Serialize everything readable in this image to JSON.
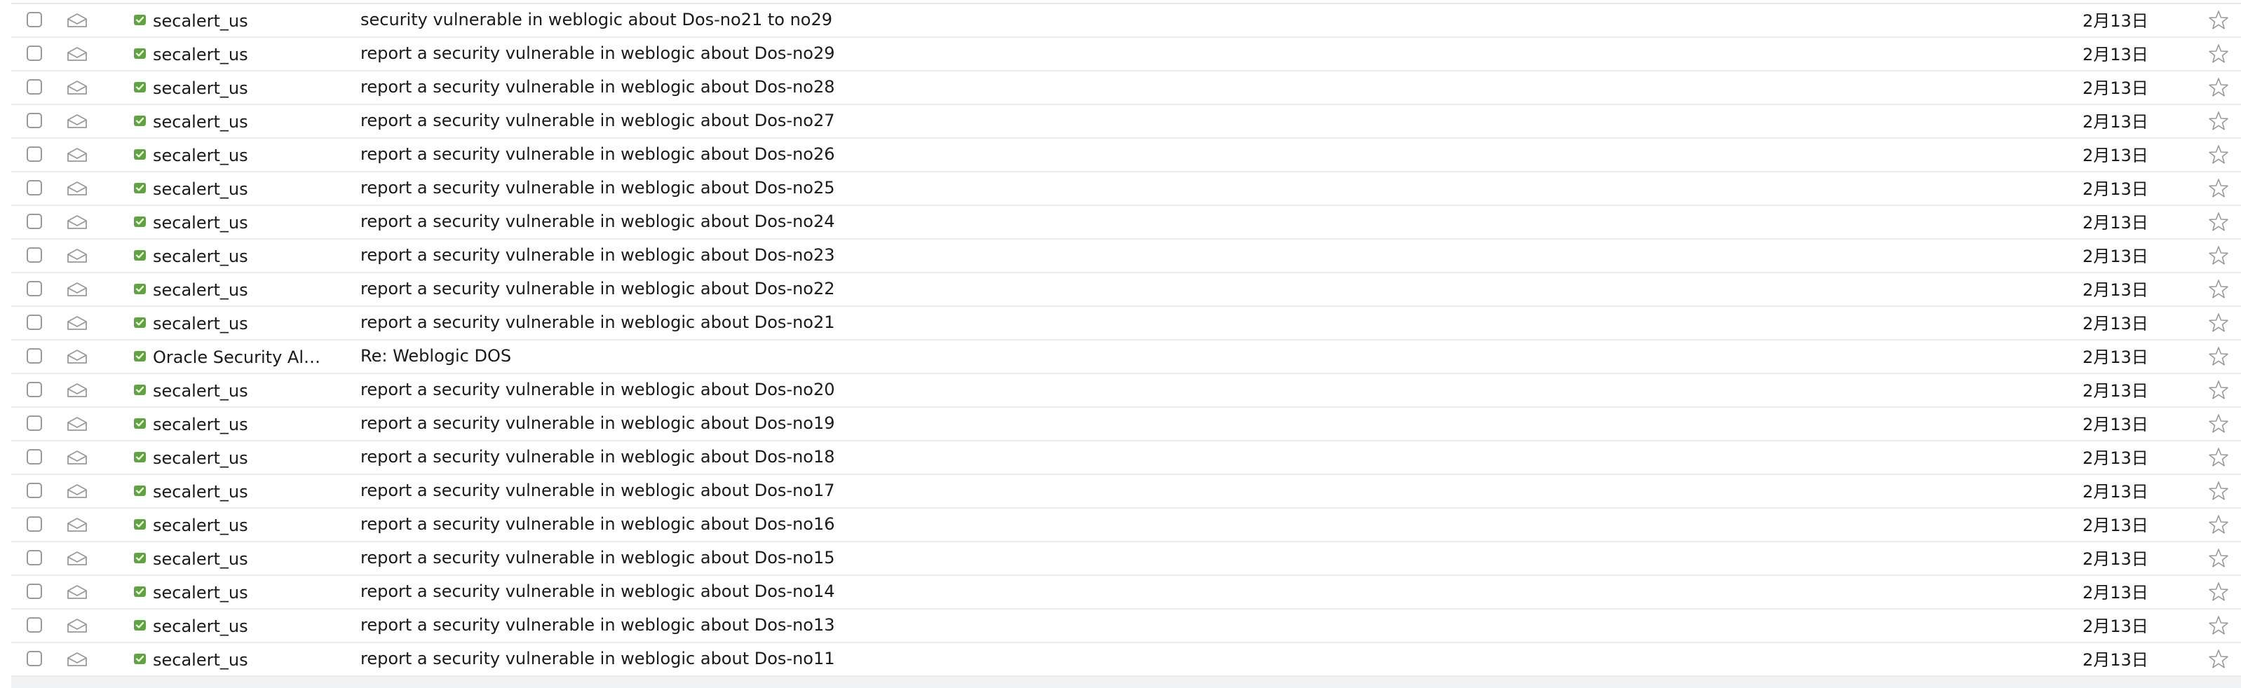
{
  "colors": {
    "verified_green": "#5aa83a",
    "icon_gray": "#9a9a9a",
    "row_divider": "#eaeaea"
  },
  "icons": {
    "checkbox": "checkbox-icon",
    "read_status": "envelope-open-icon",
    "sender_badge": "verified-check-icon",
    "flag": "star-outline-icon"
  },
  "messages": [
    {
      "sender": "secalert_us",
      "subject": "security vulnerable in weblogic about Dos-no21 to no29",
      "date": "2月13日"
    },
    {
      "sender": "secalert_us",
      "subject": "report a security vulnerable in weblogic about Dos-no29",
      "date": "2月13日"
    },
    {
      "sender": "secalert_us",
      "subject": "report a security vulnerable in weblogic about Dos-no28",
      "date": "2月13日"
    },
    {
      "sender": "secalert_us",
      "subject": "report a security vulnerable in weblogic about Dos-no27",
      "date": "2月13日"
    },
    {
      "sender": "secalert_us",
      "subject": "report a security vulnerable in weblogic about Dos-no26",
      "date": "2月13日"
    },
    {
      "sender": "secalert_us",
      "subject": "report a security vulnerable in weblogic about Dos-no25",
      "date": "2月13日"
    },
    {
      "sender": "secalert_us",
      "subject": "report a security vulnerable in weblogic about Dos-no24",
      "date": "2月13日"
    },
    {
      "sender": "secalert_us",
      "subject": "report a security vulnerable in weblogic about Dos-no23",
      "date": "2月13日"
    },
    {
      "sender": "secalert_us",
      "subject": "report a security vulnerable in weblogic about Dos-no22",
      "date": "2月13日"
    },
    {
      "sender": "secalert_us",
      "subject": "report a security vulnerable in weblogic about Dos-no21",
      "date": "2月13日"
    },
    {
      "sender": "Oracle Security Al…",
      "subject": "Re: Weblogic DOS",
      "date": "2月13日"
    },
    {
      "sender": "secalert_us",
      "subject": "report a security vulnerable in weblogic about Dos-no20",
      "date": "2月13日"
    },
    {
      "sender": "secalert_us",
      "subject": "report a security vulnerable in weblogic about Dos-no19",
      "date": "2月13日"
    },
    {
      "sender": "secalert_us",
      "subject": "report a security vulnerable in weblogic about Dos-no18",
      "date": "2月13日"
    },
    {
      "sender": "secalert_us",
      "subject": "report a security vulnerable in weblogic about Dos-no17",
      "date": "2月13日"
    },
    {
      "sender": "secalert_us",
      "subject": "report a security vulnerable in weblogic about Dos-no16",
      "date": "2月13日"
    },
    {
      "sender": "secalert_us",
      "subject": "report a security vulnerable in weblogic about Dos-no15",
      "date": "2月13日"
    },
    {
      "sender": "secalert_us",
      "subject": "report a security vulnerable in weblogic about Dos-no14",
      "date": "2月13日"
    },
    {
      "sender": "secalert_us",
      "subject": "report a security vulnerable in weblogic about Dos-no13",
      "date": "2月13日"
    },
    {
      "sender": "secalert_us",
      "subject": "report a security vulnerable in weblogic about Dos-no11",
      "date": "2月13日"
    }
  ]
}
